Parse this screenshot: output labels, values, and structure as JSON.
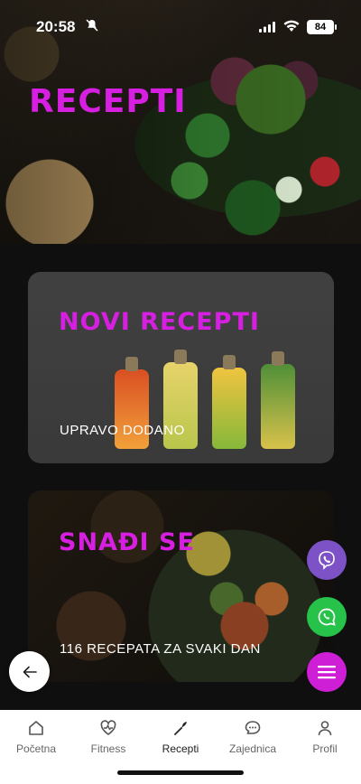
{
  "status_bar": {
    "time": "20:58",
    "battery": "84"
  },
  "header": {
    "title": "RECEPTI"
  },
  "cards": [
    {
      "title": "NOVI RECEPTI",
      "subtitle": "UPRAVO DODANO"
    },
    {
      "title": "SNAĐI SE",
      "subtitle": "116 RECEPATA ZA SVAKI DAN"
    }
  ],
  "fabs": {
    "viber": "viber-icon",
    "whatsapp": "whatsapp-icon",
    "menu": "menu-icon",
    "back": "arrow-left-icon"
  },
  "nav": {
    "items": [
      {
        "label": "Početna",
        "icon": "home-icon"
      },
      {
        "label": "Fitness",
        "icon": "heart-pulse-icon"
      },
      {
        "label": "Recepti",
        "icon": "spatula-icon",
        "active": true
      },
      {
        "label": "Zajednica",
        "icon": "chat-icon"
      },
      {
        "label": "Profil",
        "icon": "person-icon"
      }
    ]
  },
  "colors": {
    "accent": "#d61fe0",
    "viber": "#7c52c6",
    "whatsapp": "#26c24a"
  }
}
